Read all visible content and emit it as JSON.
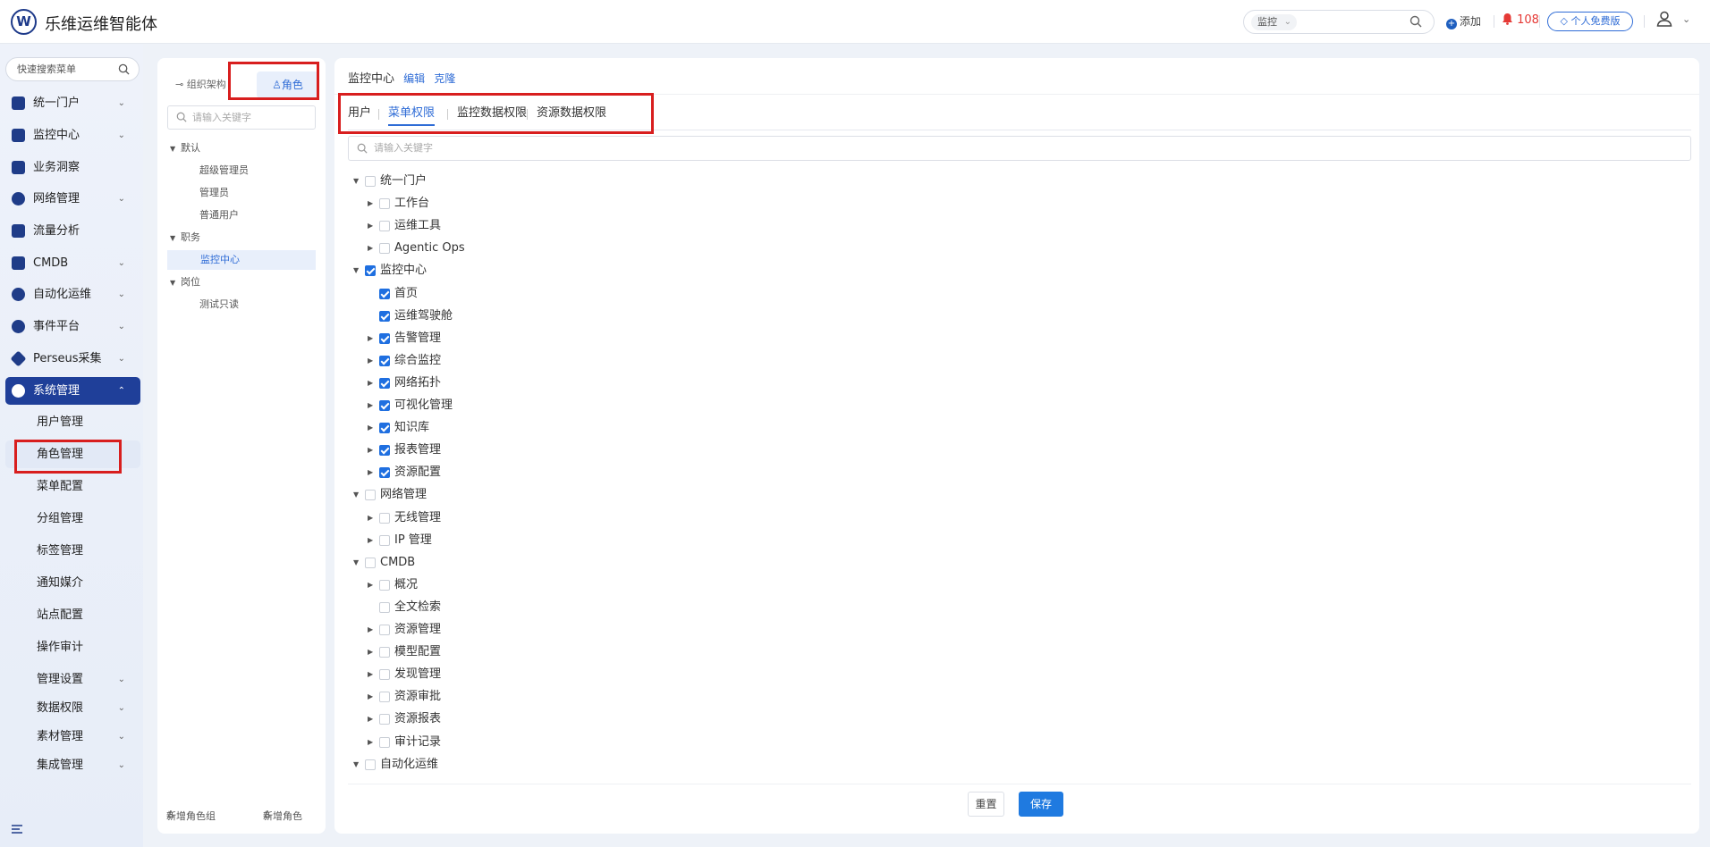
{
  "header": {
    "app_title": "乐维运维智能体",
    "logo_letter": "W",
    "search_scope": "监控",
    "add_label": "添加",
    "alert_count": "108",
    "free_badge": "个人免费版"
  },
  "sidebar": {
    "quick_search_placeholder": "快速搜索菜单",
    "items": [
      {
        "label": "统一门户",
        "expandable": true
      },
      {
        "label": "监控中心",
        "expandable": true
      },
      {
        "label": "业务洞察",
        "expandable": false
      },
      {
        "label": "网络管理",
        "expandable": true
      },
      {
        "label": "流量分析",
        "expandable": false
      },
      {
        "label": "CMDB",
        "expandable": true
      },
      {
        "label": "自动化运维",
        "expandable": true
      },
      {
        "label": "事件平台",
        "expandable": true
      },
      {
        "label": "Perseus采集",
        "expandable": true
      },
      {
        "label": "系统管理",
        "expandable": true,
        "active": true
      }
    ],
    "sub_items": [
      {
        "label": "用户管理"
      },
      {
        "label": "角色管理",
        "selected": true
      },
      {
        "label": "菜单配置"
      },
      {
        "label": "分组管理"
      },
      {
        "label": "标签管理"
      },
      {
        "label": "通知媒介"
      },
      {
        "label": "站点配置"
      },
      {
        "label": "操作审计"
      },
      {
        "label": "管理设置",
        "expandable": true
      },
      {
        "label": "数据权限",
        "expandable": true
      },
      {
        "label": "素材管理",
        "expandable": true
      },
      {
        "label": "集成管理",
        "expandable": true
      }
    ]
  },
  "role_panel": {
    "tab_org": "组织架构",
    "tab_role": "角色",
    "search_placeholder": "请输入关键字",
    "groups": [
      {
        "label": "默认",
        "children": [
          "超级管理员",
          "管理员",
          "普通用户"
        ]
      },
      {
        "label": "职务",
        "children": [
          "监控中心"
        ]
      },
      {
        "label": "岗位",
        "children": [
          "测试只读"
        ]
      }
    ],
    "footer_add_group": "新增角色组",
    "footer_add_role": "新增角色"
  },
  "main": {
    "title": "监控中心",
    "edit_link": "编辑",
    "clone_link": "克隆",
    "tabs": [
      "用户",
      "菜单权限",
      "监控数据权限",
      "资源数据权限"
    ],
    "active_tab": "菜单权限",
    "search_placeholder": "请输入关键字",
    "tree": [
      {
        "label": "统一门户",
        "level": 0,
        "expand": "open",
        "checked": false
      },
      {
        "label": "工作台",
        "level": 1,
        "expand": "closed",
        "checked": false
      },
      {
        "label": "运维工具",
        "level": 1,
        "expand": "closed",
        "checked": false
      },
      {
        "label": "Agentic Ops",
        "level": 1,
        "expand": "closed",
        "checked": false
      },
      {
        "label": "监控中心",
        "level": 0,
        "expand": "open",
        "checked": true
      },
      {
        "label": "首页",
        "level": 1,
        "expand": "none",
        "checked": true
      },
      {
        "label": "运维驾驶舱",
        "level": 1,
        "expand": "none",
        "checked": true
      },
      {
        "label": "告警管理",
        "level": 1,
        "expand": "closed",
        "checked": true
      },
      {
        "label": "综合监控",
        "level": 1,
        "expand": "closed",
        "checked": true
      },
      {
        "label": "网络拓扑",
        "level": 1,
        "expand": "closed",
        "checked": true
      },
      {
        "label": "可视化管理",
        "level": 1,
        "expand": "closed",
        "checked": true
      },
      {
        "label": "知识库",
        "level": 1,
        "expand": "closed",
        "checked": true
      },
      {
        "label": "报表管理",
        "level": 1,
        "expand": "closed",
        "checked": true
      },
      {
        "label": "资源配置",
        "level": 1,
        "expand": "closed",
        "checked": true
      },
      {
        "label": "网络管理",
        "level": 0,
        "expand": "open",
        "checked": false
      },
      {
        "label": "无线管理",
        "level": 1,
        "expand": "closed",
        "checked": false
      },
      {
        "label": "IP 管理",
        "level": 1,
        "expand": "closed",
        "checked": false
      },
      {
        "label": "CMDB",
        "level": 0,
        "expand": "open",
        "checked": false
      },
      {
        "label": "概况",
        "level": 1,
        "expand": "closed",
        "checked": false
      },
      {
        "label": "全文检索",
        "level": 1,
        "expand": "none",
        "checked": false
      },
      {
        "label": "资源管理",
        "level": 1,
        "expand": "closed",
        "checked": false
      },
      {
        "label": "模型配置",
        "level": 1,
        "expand": "closed",
        "checked": false
      },
      {
        "label": "发现管理",
        "level": 1,
        "expand": "closed",
        "checked": false
      },
      {
        "label": "资源审批",
        "level": 1,
        "expand": "closed",
        "checked": false
      },
      {
        "label": "资源报表",
        "level": 1,
        "expand": "closed",
        "checked": false
      },
      {
        "label": "审计记录",
        "level": 1,
        "expand": "closed",
        "checked": false
      },
      {
        "label": "自动化运维",
        "level": 0,
        "expand": "open",
        "checked": false
      }
    ],
    "reset_label": "重置",
    "save_label": "保存"
  },
  "colors": {
    "accent": "#2f6cd6",
    "sidebar_active": "#1f3f99",
    "checkbox_on": "#1f6fe0",
    "alert": "#e53935",
    "annotation_red": "#d81e1e"
  }
}
